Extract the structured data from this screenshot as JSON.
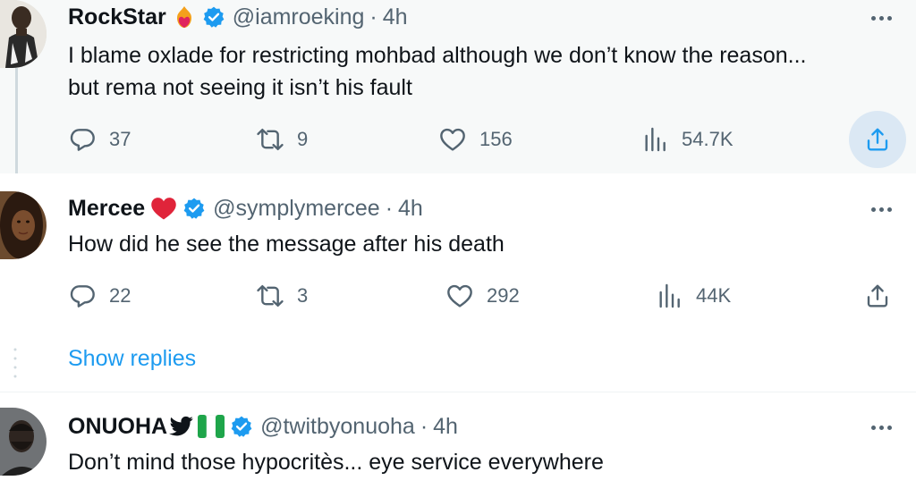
{
  "tweets": [
    {
      "name": "RockStar",
      "name_emoji": "heart-on-fire-icon",
      "handle": "@iamroeking",
      "separator": "·",
      "time": "4h",
      "text_line1": "I blame oxlade for restricting mohbad although we don’t know the reason...",
      "text_line2": "but rema not seeing it isn’t his fault",
      "replies": "37",
      "reposts": "9",
      "likes": "156",
      "views": "54.7K"
    },
    {
      "name": "Mercee",
      "name_emoji": "red-heart-icon",
      "handle": "@symplymercee",
      "separator": "·",
      "time": "4h",
      "text_line1": "How did he see the message after his death",
      "replies": "22",
      "reposts": "3",
      "likes": "292",
      "views": "44K"
    },
    {
      "name": "ONUOHA",
      "name_emoji": "bird-and-nigeria-flag-icons",
      "handle": "@twitbyonuoha",
      "separator": "·",
      "time": "4h",
      "text_line1": "Don’t mind those hypocritès... eye service everywhere"
    }
  ],
  "show_replies_label": "Show replies",
  "colors": {
    "accent": "#1d9bf0",
    "muted": "#536471",
    "text": "#0f1419",
    "hover_bg": "#f7f9f9",
    "share_active_bg": "#dbe8f4"
  }
}
